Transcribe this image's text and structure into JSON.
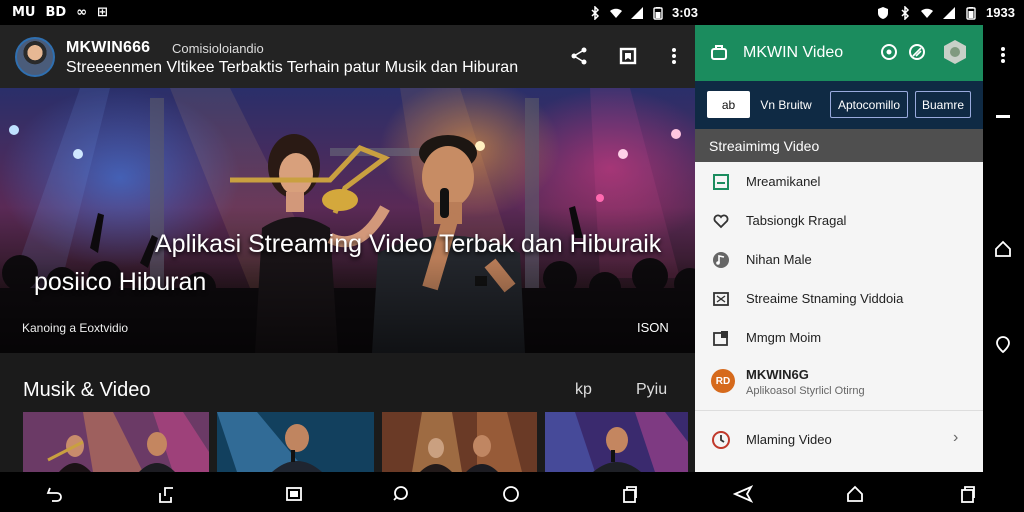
{
  "status_bar": {
    "left_glyphs": [
      "MU",
      "BD",
      "∞",
      "⊞"
    ],
    "time_left": "3:03",
    "time_right": "1933"
  },
  "video_app": {
    "channel_name": "MKWIN666",
    "channel_sub": "Comisioloiandio",
    "video_title": "Streeeenmen Vltikee Terbaktis Terhain patur Musik dan Hiburan",
    "hero": {
      "title": "Aplikasi Streaming Video Terbak dan Hiburaik",
      "subtitle": "posiico Hiburan",
      "meta": "Kanoing a Eoxtvidio",
      "duration": "ISON"
    },
    "section": {
      "title": "Musik & Video",
      "action_a": "kp",
      "action_b": "Pyiu"
    }
  },
  "drawer": {
    "title": "MKWIN Video",
    "tabs": [
      "ab",
      "Vn Bruitw",
      "Aptocomillo",
      "Buamre"
    ],
    "section_title": "Streaimimg Video",
    "items": [
      {
        "label": "Mreamikanel",
        "icon": "square-outline-icon"
      },
      {
        "label": "Tabsiongk Rragal",
        "icon": "heart-icon"
      },
      {
        "label": "Nihan Male",
        "icon": "music-note-icon"
      },
      {
        "label": "Streaime Stnaming Viddoia",
        "icon": "crop-icon"
      },
      {
        "label": "Mmgm Moim",
        "icon": "grid-icon"
      }
    ],
    "account": {
      "avatar_text": "RD",
      "name": "MKWIN6G",
      "sub": "Aplikoasol Styrlicl Otirng"
    },
    "bottom_item": {
      "label": "Mlaming Video",
      "icon": "clock-icon"
    }
  }
}
